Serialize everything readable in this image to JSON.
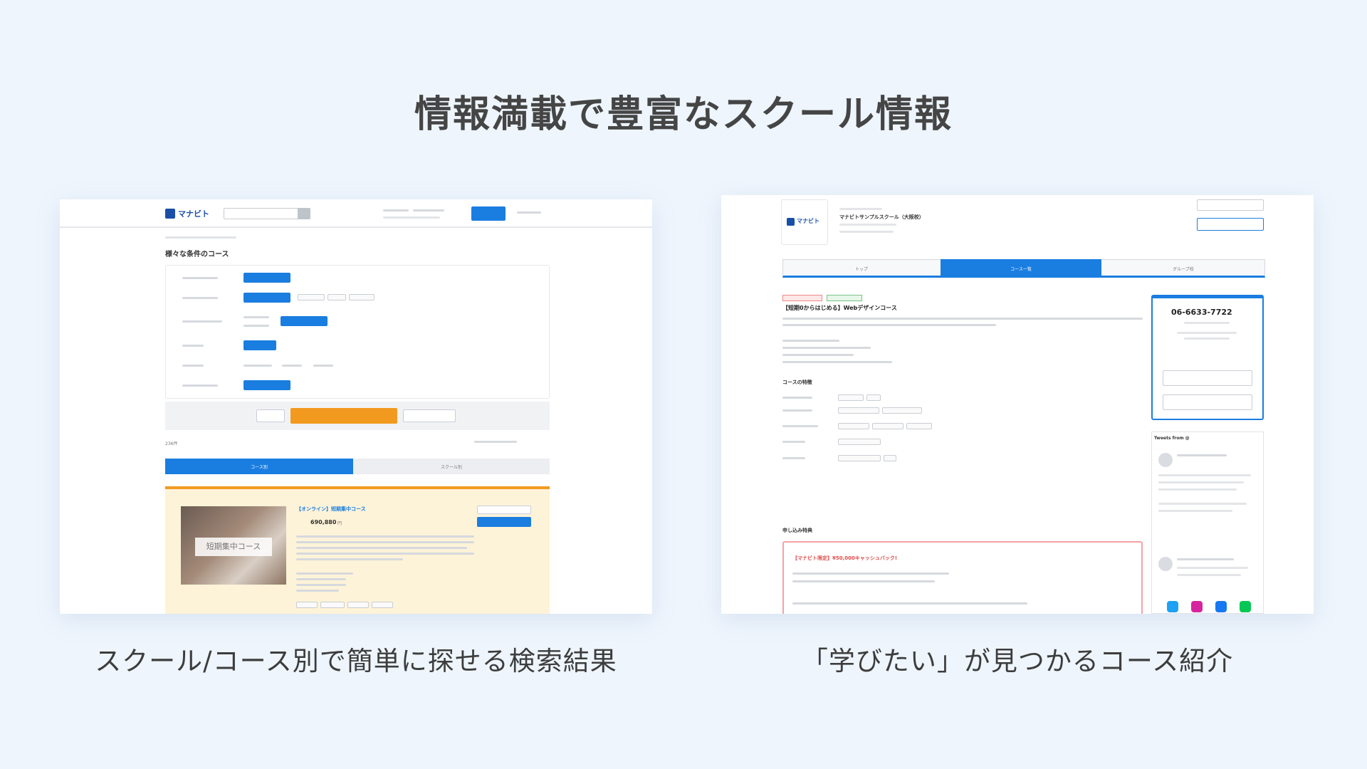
{
  "headline": "情報満載で豊富なスクール情報",
  "left_caption": "スクール/コース別で簡単に探せる検索結果",
  "right_caption": "「学びたい」が見つかるコース紹介",
  "left_shot": {
    "logo": "マナビト",
    "page_title": "様々な条件のコース",
    "search_button": "",
    "result_count": "236件",
    "tab_course": "コース別",
    "tab_school": "スクール別",
    "card_image_label": "短期集中コース",
    "card_title": "【オンライン】短期集中コース",
    "card_price": "690,880",
    "card_price_unit": "円",
    "colors": {
      "accent": "#1a7de0",
      "orange": "#f29a20",
      "card_bg": "#fdf3d8"
    }
  },
  "right_shot": {
    "logo": "マナビト",
    "school_name": "マナビトサンプルスクール（大阪校）",
    "tab_top": "トップ",
    "tab_courses": "コース一覧",
    "tab_group": "グループ校",
    "course_title": "【短期0からはじめる】Webデザインコース",
    "section_detail": "コースの特徴",
    "section_apply": "申し込み特典",
    "phone": "06-6633-7722",
    "campaign": "【マナビト限定】¥50,000キャッシュバック!",
    "tweets_header": "Tweets from @",
    "colors": {
      "accent": "#1a7de0",
      "campaign_border": "#f3a3a3"
    }
  }
}
